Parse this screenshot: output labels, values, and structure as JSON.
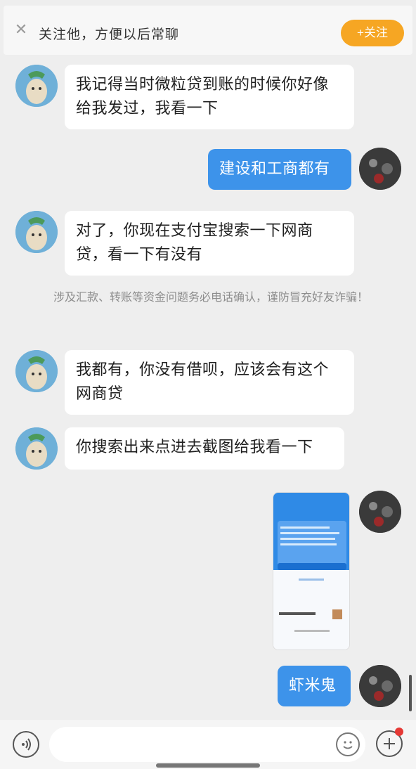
{
  "banner": {
    "close_glyph": "✕",
    "text": "关注他，方便以后常聊",
    "follow_label": "+关注",
    "follow_color": "#f6a623"
  },
  "messages": [
    {
      "side": "in",
      "text": "我记得当时微粒贷到账的时候你好像给我发过，我看一下"
    },
    {
      "side": "out",
      "text": "建设和工商都有"
    },
    {
      "side": "in",
      "text": "对了，你现在支付宝搜索一下网商贷，看一下有没有"
    },
    {
      "side": "in",
      "text": "我都有，你没有借呗，应该会有这个网商贷"
    },
    {
      "side": "in",
      "text": "你搜索出来点进去截图给我看一下"
    },
    {
      "side": "out",
      "text": "虾米鬼"
    }
  ],
  "notice": "涉及汇款、转账等资金问题务必电话确认，谨防冒充好友诈骗！",
  "colors": {
    "outgoing_bubble": "#3d93ea",
    "incoming_bubble": "#ffffff",
    "background": "#eeeeee"
  },
  "icons": {
    "voice": "voice-icon",
    "emoji": "emoji-icon",
    "plus": "plus-icon"
  }
}
